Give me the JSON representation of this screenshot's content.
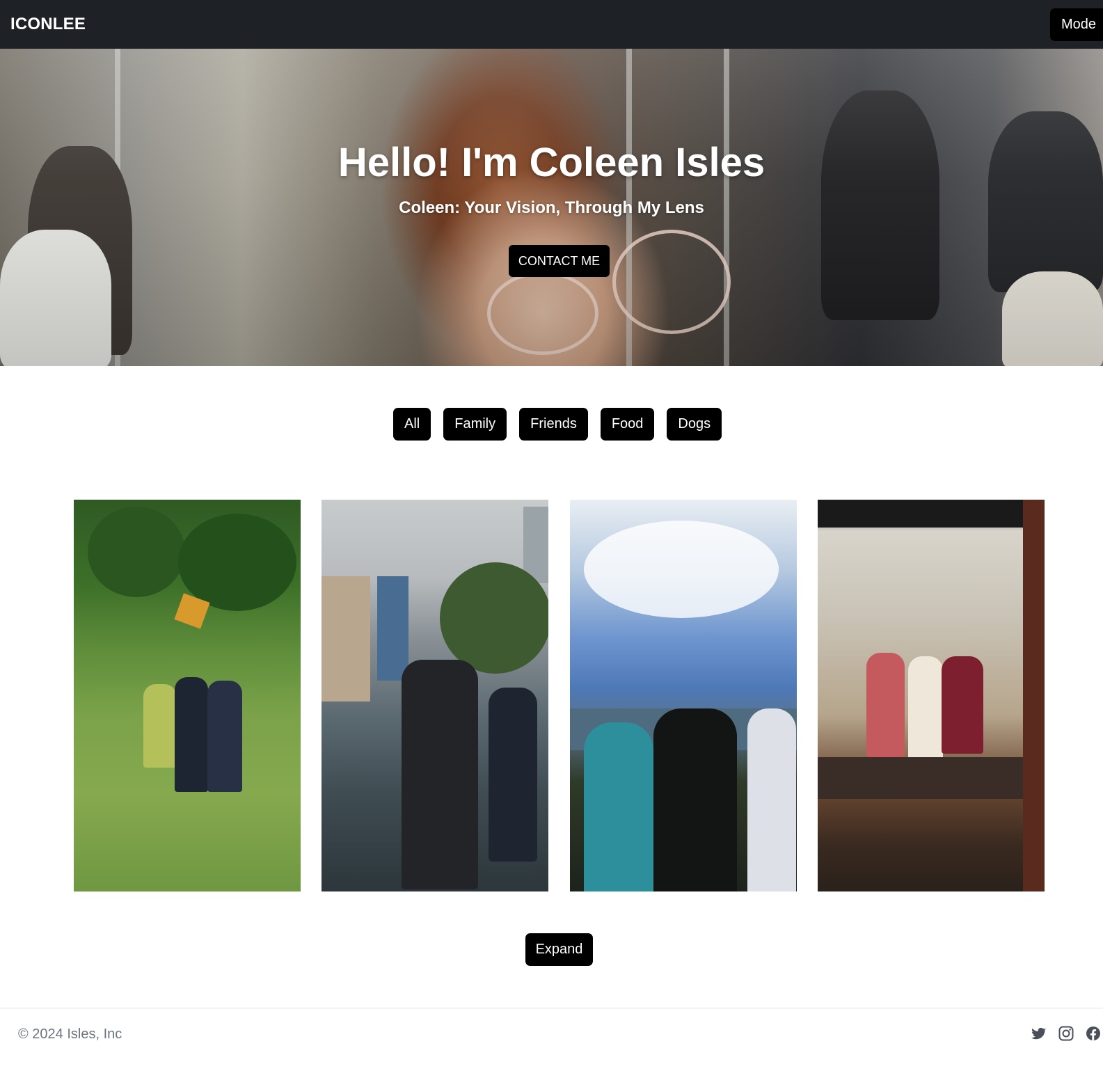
{
  "navbar": {
    "brand": "ICONLEE",
    "mode_label": "Mode"
  },
  "hero": {
    "title": "Hello! I'm Coleen Isles",
    "subtitle": "Coleen: Your Vision, Through My Lens",
    "contact_label": "CONTACT ME"
  },
  "filters": [
    "All",
    "Family",
    "Friends",
    "Food",
    "Dogs"
  ],
  "gallery": {
    "photos": [
      {
        "subject": "family-in-park"
      },
      {
        "subject": "city-walk"
      },
      {
        "subject": "mountain-view"
      },
      {
        "subject": "mirror-selfie"
      }
    ],
    "expand_label": "Expand"
  },
  "footer": {
    "copyright": "© 2024 Isles, Inc",
    "social_icons": [
      "twitter-icon",
      "instagram-icon",
      "facebook-icon"
    ]
  },
  "colors": {
    "navbar_bg": "#1e2126",
    "button_bg": "#000000",
    "button_text": "#ffffff",
    "footer_text": "#6c757d"
  }
}
